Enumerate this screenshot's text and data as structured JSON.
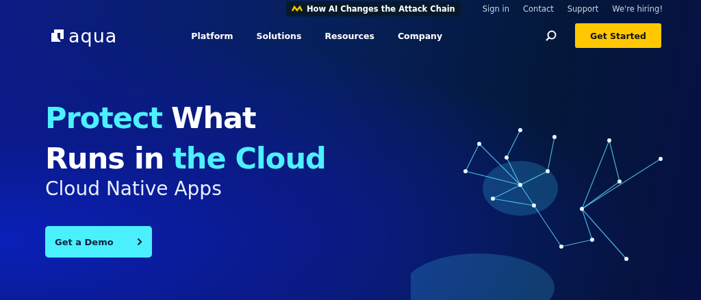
{
  "top_bar": {
    "promo": "How AI Changes the Attack Chain",
    "links": [
      "Sign in",
      "Contact",
      "Support",
      "We're hiring!"
    ]
  },
  "nav": {
    "logo": "aqua",
    "items": [
      "Platform",
      "Solutions",
      "Resources",
      "Company"
    ],
    "cta": "Get Started"
  },
  "hero": {
    "headline": [
      [
        {
          "text": "Protect",
          "highlight": true
        },
        {
          "text": "What",
          "highlight": false
        }
      ],
      [
        {
          "text": "Runs in",
          "highlight": false
        },
        {
          "text": "the Cloud",
          "highlight": true
        }
      ]
    ],
    "subtitle": "Cloud Native Apps",
    "button": "Get a Demo"
  }
}
